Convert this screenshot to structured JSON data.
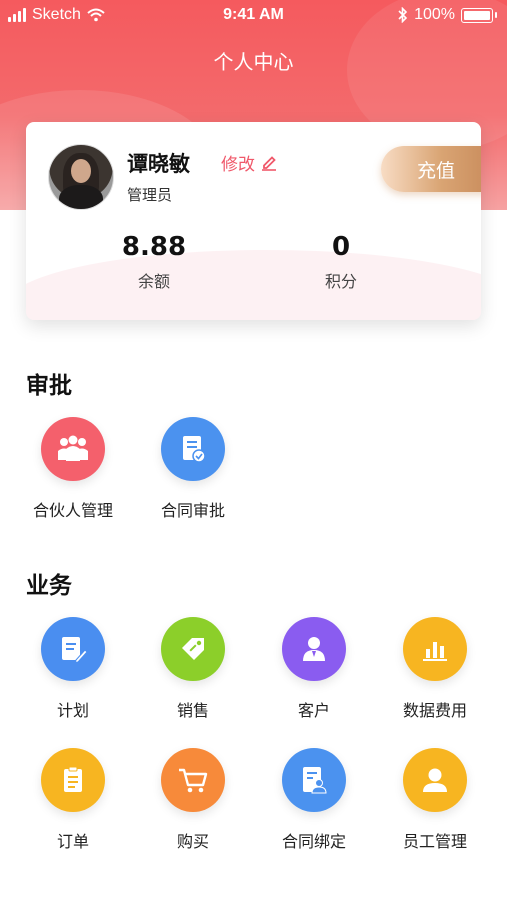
{
  "status_bar": {
    "carrier": "Sketch",
    "time": "9:41 AM",
    "battery": "100%"
  },
  "header": {
    "title": "个人中心"
  },
  "profile": {
    "name": "谭晓敏",
    "role": "管理员",
    "edit_label": "修改",
    "recharge_label": "充值",
    "balance": {
      "value": "8.88",
      "label": "余额"
    },
    "points": {
      "value": "0",
      "label": "积分"
    }
  },
  "approval": {
    "title": "审批",
    "items": [
      {
        "label": "合伙人管理",
        "icon": "partners-icon",
        "color": "#f4606c"
      },
      {
        "label": "合同审批",
        "icon": "contract-approval-icon",
        "color": "#4b92ef"
      }
    ]
  },
  "business": {
    "title": "业务",
    "items": [
      {
        "label": "计划",
        "icon": "plan-icon",
        "color": "#4a8ef0"
      },
      {
        "label": "销售",
        "icon": "sales-tag-icon",
        "color": "#8ccf2a"
      },
      {
        "label": "客户",
        "icon": "customer-icon",
        "color": "#8a5cf0"
      },
      {
        "label": "数据费用",
        "icon": "data-chart-icon",
        "color": "#f7b521"
      },
      {
        "label": "订单",
        "icon": "order-icon",
        "color": "#f7b521"
      },
      {
        "label": "购买",
        "icon": "cart-icon",
        "color": "#f78a3a"
      },
      {
        "label": "合同绑定",
        "icon": "contract-bind-icon",
        "color": "#4b92ef"
      },
      {
        "label": "员工管理",
        "icon": "employee-icon",
        "color": "#f7b521"
      }
    ]
  }
}
